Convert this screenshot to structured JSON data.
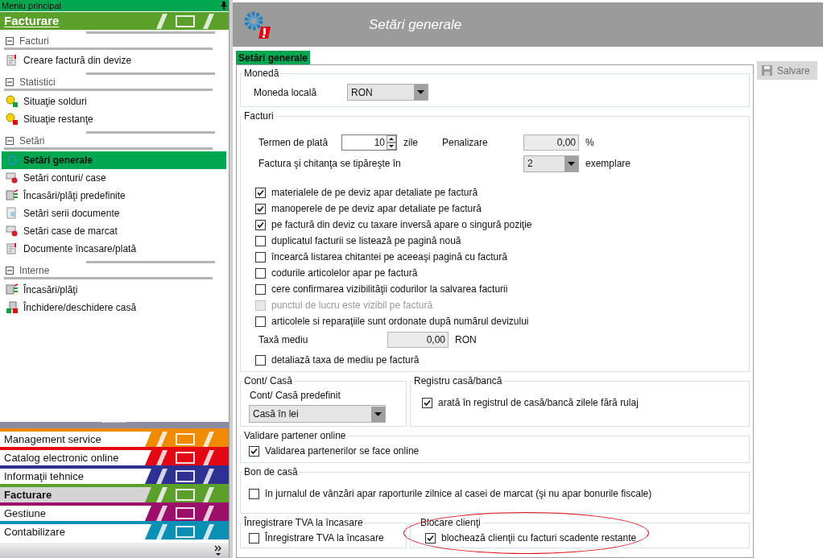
{
  "sidebar": {
    "title": "Meniu principal",
    "module_title": "Facturare",
    "sections": [
      {
        "label": "Facturi",
        "expanded": true,
        "items": [
          {
            "label": "Creare factură din devize",
            "selected": false
          }
        ]
      },
      {
        "label": "Statistici",
        "expanded": true,
        "items": [
          {
            "label": "Situaţie solduri",
            "selected": false
          },
          {
            "label": "Situaţie restanţe",
            "selected": false
          }
        ]
      },
      {
        "label": "Setări",
        "expanded": true,
        "items": [
          {
            "label": "Setări generale",
            "selected": true
          },
          {
            "label": "Setări conturi/ case",
            "selected": false
          },
          {
            "label": "Încasări/plăţi predefinite",
            "selected": false
          },
          {
            "label": "Setări serii documente",
            "selected": false
          },
          {
            "label": "Setări case de marcat",
            "selected": false
          },
          {
            "label": "Documente încasare/plată",
            "selected": false
          }
        ]
      },
      {
        "label": "Interne",
        "expanded": true,
        "items": [
          {
            "label": "Încasări/plăţi",
            "selected": false
          },
          {
            "label": "Închidere/deschidere casă",
            "selected": false
          }
        ]
      }
    ],
    "modules": [
      {
        "label": "Management service",
        "selected": false,
        "color": "#f08a00"
      },
      {
        "label": "Catalog electronic online",
        "selected": false,
        "color": "#e30613"
      },
      {
        "label": "Informaţii tehnice",
        "selected": false,
        "color": "#2e3192"
      },
      {
        "label": "Facturare",
        "selected": true,
        "color": "#5ca02c"
      },
      {
        "label": "Gestiune",
        "selected": false,
        "color": "#9b0f6b"
      },
      {
        "label": "Contabilizare",
        "selected": false,
        "color": "#0a8fb5"
      }
    ]
  },
  "header": {
    "title": "Setări generale"
  },
  "tabs": [
    {
      "label": "Setări generale",
      "selected": true
    }
  ],
  "save_button": {
    "label": "Salvare",
    "disabled": true
  },
  "moneda": {
    "title": "Monedă",
    "field_label": "Moneda locală",
    "value": "RON"
  },
  "facturi": {
    "title": "Facturi",
    "term_label": "Termen de plată",
    "term_value": "10",
    "term_unit": "zile",
    "penalty_label": "Penalizare",
    "penalty_value": "0,00",
    "penalty_unit": "%",
    "copies_label": "Factura şi chitanţa se tipăreşte în",
    "copies_value": "2",
    "copies_unit": "exemplare",
    "options": [
      {
        "label": "materialele de pe deviz apar detaliate pe factură",
        "checked": true,
        "disabled": false
      },
      {
        "label": "manoperele de pe deviz apar detaliate pe factură",
        "checked": true,
        "disabled": false
      },
      {
        "label": "pe factură din deviz cu taxare inversă apare o singură poziţie",
        "checked": true,
        "disabled": false
      },
      {
        "label": "duplicatul facturii se listează pe pagină nouă",
        "checked": false,
        "disabled": false
      },
      {
        "label": "încearcă listarea chitantei pe aceeaşi pagină cu factură",
        "checked": false,
        "disabled": false
      },
      {
        "label": "codurile articolelor apar pe factură",
        "checked": false,
        "disabled": false
      },
      {
        "label": "cere confirmarea vizibilităţii codurilor la salvarea facturii",
        "checked": false,
        "disabled": false
      },
      {
        "label": "punctul de lucru este vizibil pe factură",
        "checked": false,
        "disabled": true
      },
      {
        "label": "articolele si reparaţiile sunt ordonate după numărul devizului",
        "checked": false,
        "disabled": false
      }
    ],
    "tax_label": "Taxă mediu",
    "tax_value": "0,00",
    "tax_unit": "RON",
    "tax_option": {
      "label": "detaliază taxa de mediu pe factură",
      "checked": false,
      "disabled": false
    }
  },
  "cont_casa": {
    "title": "Cont/ Casă",
    "field_label": "Cont/ Casă predefinit",
    "value": "Casă în lei"
  },
  "registru": {
    "title": "Registru casă/bancă",
    "option": {
      "label": "arată în registrul de casă/bancă zilele fără rulaj",
      "checked": true,
      "disabled": false
    }
  },
  "validare": {
    "title": "Validare partener online",
    "option": {
      "label": "Validarea partenerilor se face online",
      "checked": true,
      "disabled": false
    }
  },
  "bon": {
    "title": "Bon de casă",
    "option": {
      "label": "în jurnalul de vânzări apar raporturile zilnice al casei de marcat (şi nu apar bonurile fiscale)",
      "checked": false,
      "disabled": false
    }
  },
  "tva": {
    "title": "Înregistrare TVA la încasare",
    "option": {
      "label": "Înregistrare TVA la încasare",
      "checked": false,
      "disabled": false
    }
  },
  "blocare": {
    "title": "Blocare clienţi",
    "highlighted": true,
    "option": {
      "label": "blochează clienţii cu facturi scadente restante",
      "checked": true,
      "disabled": false
    }
  }
}
